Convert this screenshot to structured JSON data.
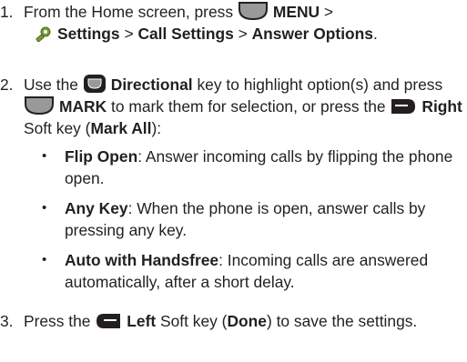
{
  "steps": [
    {
      "num": "1.",
      "t1": "From the Home screen, press ",
      "k1": "MENU",
      "t2": " >",
      "settings": "Settings",
      "t3": " > ",
      "call_settings": "Call Settings",
      "t4": " > ",
      "answer_options": "Answer Options",
      "t5": "."
    },
    {
      "num": "2.",
      "t1": "Use the ",
      "k1": "Directional",
      "t2": " key to highlight option(s) and press ",
      "k2": "MARK",
      "t3": " to mark them for selection, or press the ",
      "k3": "Right",
      "t4": " Soft key (",
      "k4": "Mark All",
      "t5": "):"
    },
    {
      "num": "3.",
      "t1": "Press the ",
      "k1": "Left",
      "t2": " Soft key (",
      "k2": "Done",
      "t3": ") to save the settings."
    }
  ],
  "bullets": [
    {
      "dot": "•",
      "term": "Flip Open",
      "desc": ": Answer incoming calls by flipping the phone open."
    },
    {
      "dot": "•",
      "term": "Any Key",
      "desc": ": When the phone is open, answer calls by pressing any key."
    },
    {
      "dot": "•",
      "term": "Auto with Handsfree",
      "desc": ": Incoming calls are answered automatically, after a short delay."
    }
  ],
  "icons": {
    "key_fill": "#999999",
    "key_stroke": "#231f20",
    "soft_key_fill": "#231f20",
    "settings_icon_color": "#7a9a3a"
  }
}
